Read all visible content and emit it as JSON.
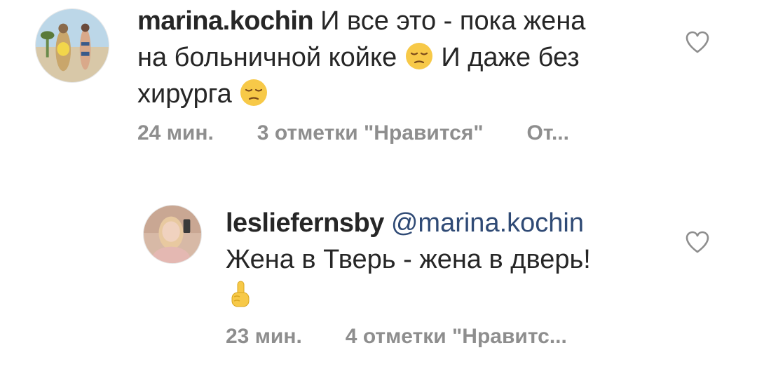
{
  "comments": [
    {
      "username": "marina.kochin",
      "text_line1": "И все это - пока жена",
      "text_line2a": "на больничной койке",
      "text_line2b": "И даже без",
      "text_line3": "хирурга",
      "emoji_icon": "pensive-face-icon",
      "time": "24 мин.",
      "likes": "3 отметки \"Нравится\"",
      "reply": "От..."
    },
    {
      "username": "lesliefernsby",
      "mention": "@marina.kochin",
      "text_line1": "Жена в Тверь - жена в дверь!",
      "emoji_icon": "index-pointing-up-icon",
      "time": "23 мин.",
      "likes": "4 отметки \"Нравитс..."
    }
  ],
  "colors": {
    "text": "#262626",
    "meta": "#8e8e8e",
    "mention": "#2f4a75",
    "heart_outline": "#8e8e8e",
    "emoji_yellow": "#f7c948"
  }
}
